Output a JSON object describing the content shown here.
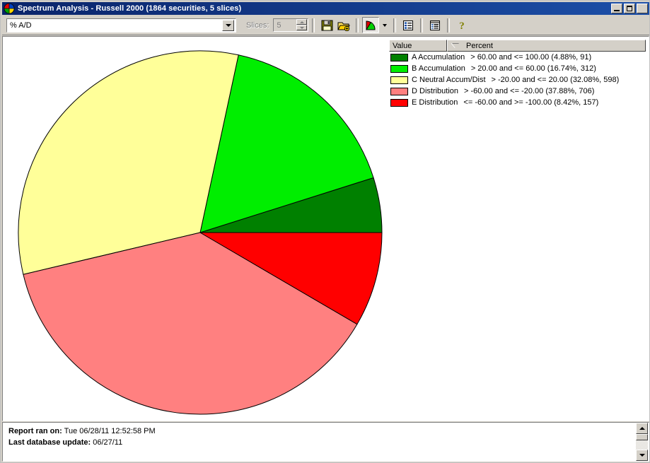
{
  "window": {
    "title": "Spectrum Analysis - Russell 2000 (1864 securities, 5 slices)",
    "icon": "pie-chart-icon",
    "minimize_label": "Minimize",
    "maximize_label": "Maximize",
    "close_label": "Close"
  },
  "toolbar": {
    "combo_value": "% A/D",
    "combo_placeholder": "% A/D",
    "slices_label": "Slices:",
    "slices_value": "5",
    "buttons": [
      {
        "name": "save-button",
        "label": "Save",
        "icon": "floppy-disk-icon"
      },
      {
        "name": "open-button",
        "label": "Open",
        "icon": "open-folder-add-icon"
      },
      {
        "name": "pie-view-button",
        "label": "Pie Chart View",
        "icon": "pie-chart-icon",
        "pressed": true
      },
      {
        "name": "list-view-button",
        "label": "List View",
        "icon": "list-icon"
      },
      {
        "name": "report-view-button",
        "label": "Report View",
        "icon": "report-icon"
      },
      {
        "name": "help-button",
        "label": "Help",
        "icon": "question-mark-icon"
      }
    ]
  },
  "legend": {
    "columns": [
      "Value",
      "Percent"
    ],
    "sort_indicator": "sort-descending-icon",
    "rows": [
      {
        "label": "A Accumulation",
        "range": "> 60.00 and <= 100.00 (4.88%, 91)",
        "color": "#008000"
      },
      {
        "label": "B Accumulation",
        "range": "> 20.00 and <= 60.00 (16.74%, 312)",
        "color": "#00EE00"
      },
      {
        "label": "C Neutral Accum/Dist",
        "range": "> -20.00 and <= 20.00 (32.08%, 598)",
        "color": "#FFFF99"
      },
      {
        "label": "D Distribution",
        "range": "> -60.00 and <= -20.00 (37.88%, 706)",
        "color": "#FF8080"
      },
      {
        "label": "E Distribution",
        "range": "<= -60.00 and >= -100.00 (8.42%, 157)",
        "color": "#FF0000"
      }
    ]
  },
  "status": {
    "report_ran_label": "Report ran on:",
    "report_ran_value": "Tue 06/28/11 12:52:58 PM",
    "last_update_label": "Last database update:",
    "last_update_value": "06/27/11"
  },
  "chart_data": {
    "type": "pie",
    "title": "Spectrum Analysis - Russell 2000",
    "start_angle_deg": 0,
    "direction": "counterclockwise",
    "center": [
      279,
      327
    ],
    "radius": 257,
    "total_count": 1864,
    "slice_count": 5,
    "categories": [
      "A Accumulation",
      "B Accumulation",
      "C Neutral Accum/Dist",
      "D Distribution",
      "E Distribution"
    ],
    "values": [
      4.88,
      16.74,
      32.08,
      37.88,
      8.42
    ],
    "counts": [
      91,
      312,
      598,
      706,
      157
    ],
    "colors": [
      "#008000",
      "#00EE00",
      "#FFFF99",
      "#FF8080",
      "#FF0000"
    ],
    "ranges": [
      "> 60.00 and <= 100.00",
      "> 20.00 and <= 60.00",
      "> -20.00 and <= 20.00",
      "> -60.00 and <= -20.00",
      "<= -60.00 and >= -100.00"
    ],
    "ylabel": "",
    "xlabel": "",
    "legend_position": "top-right",
    "grid": false
  }
}
